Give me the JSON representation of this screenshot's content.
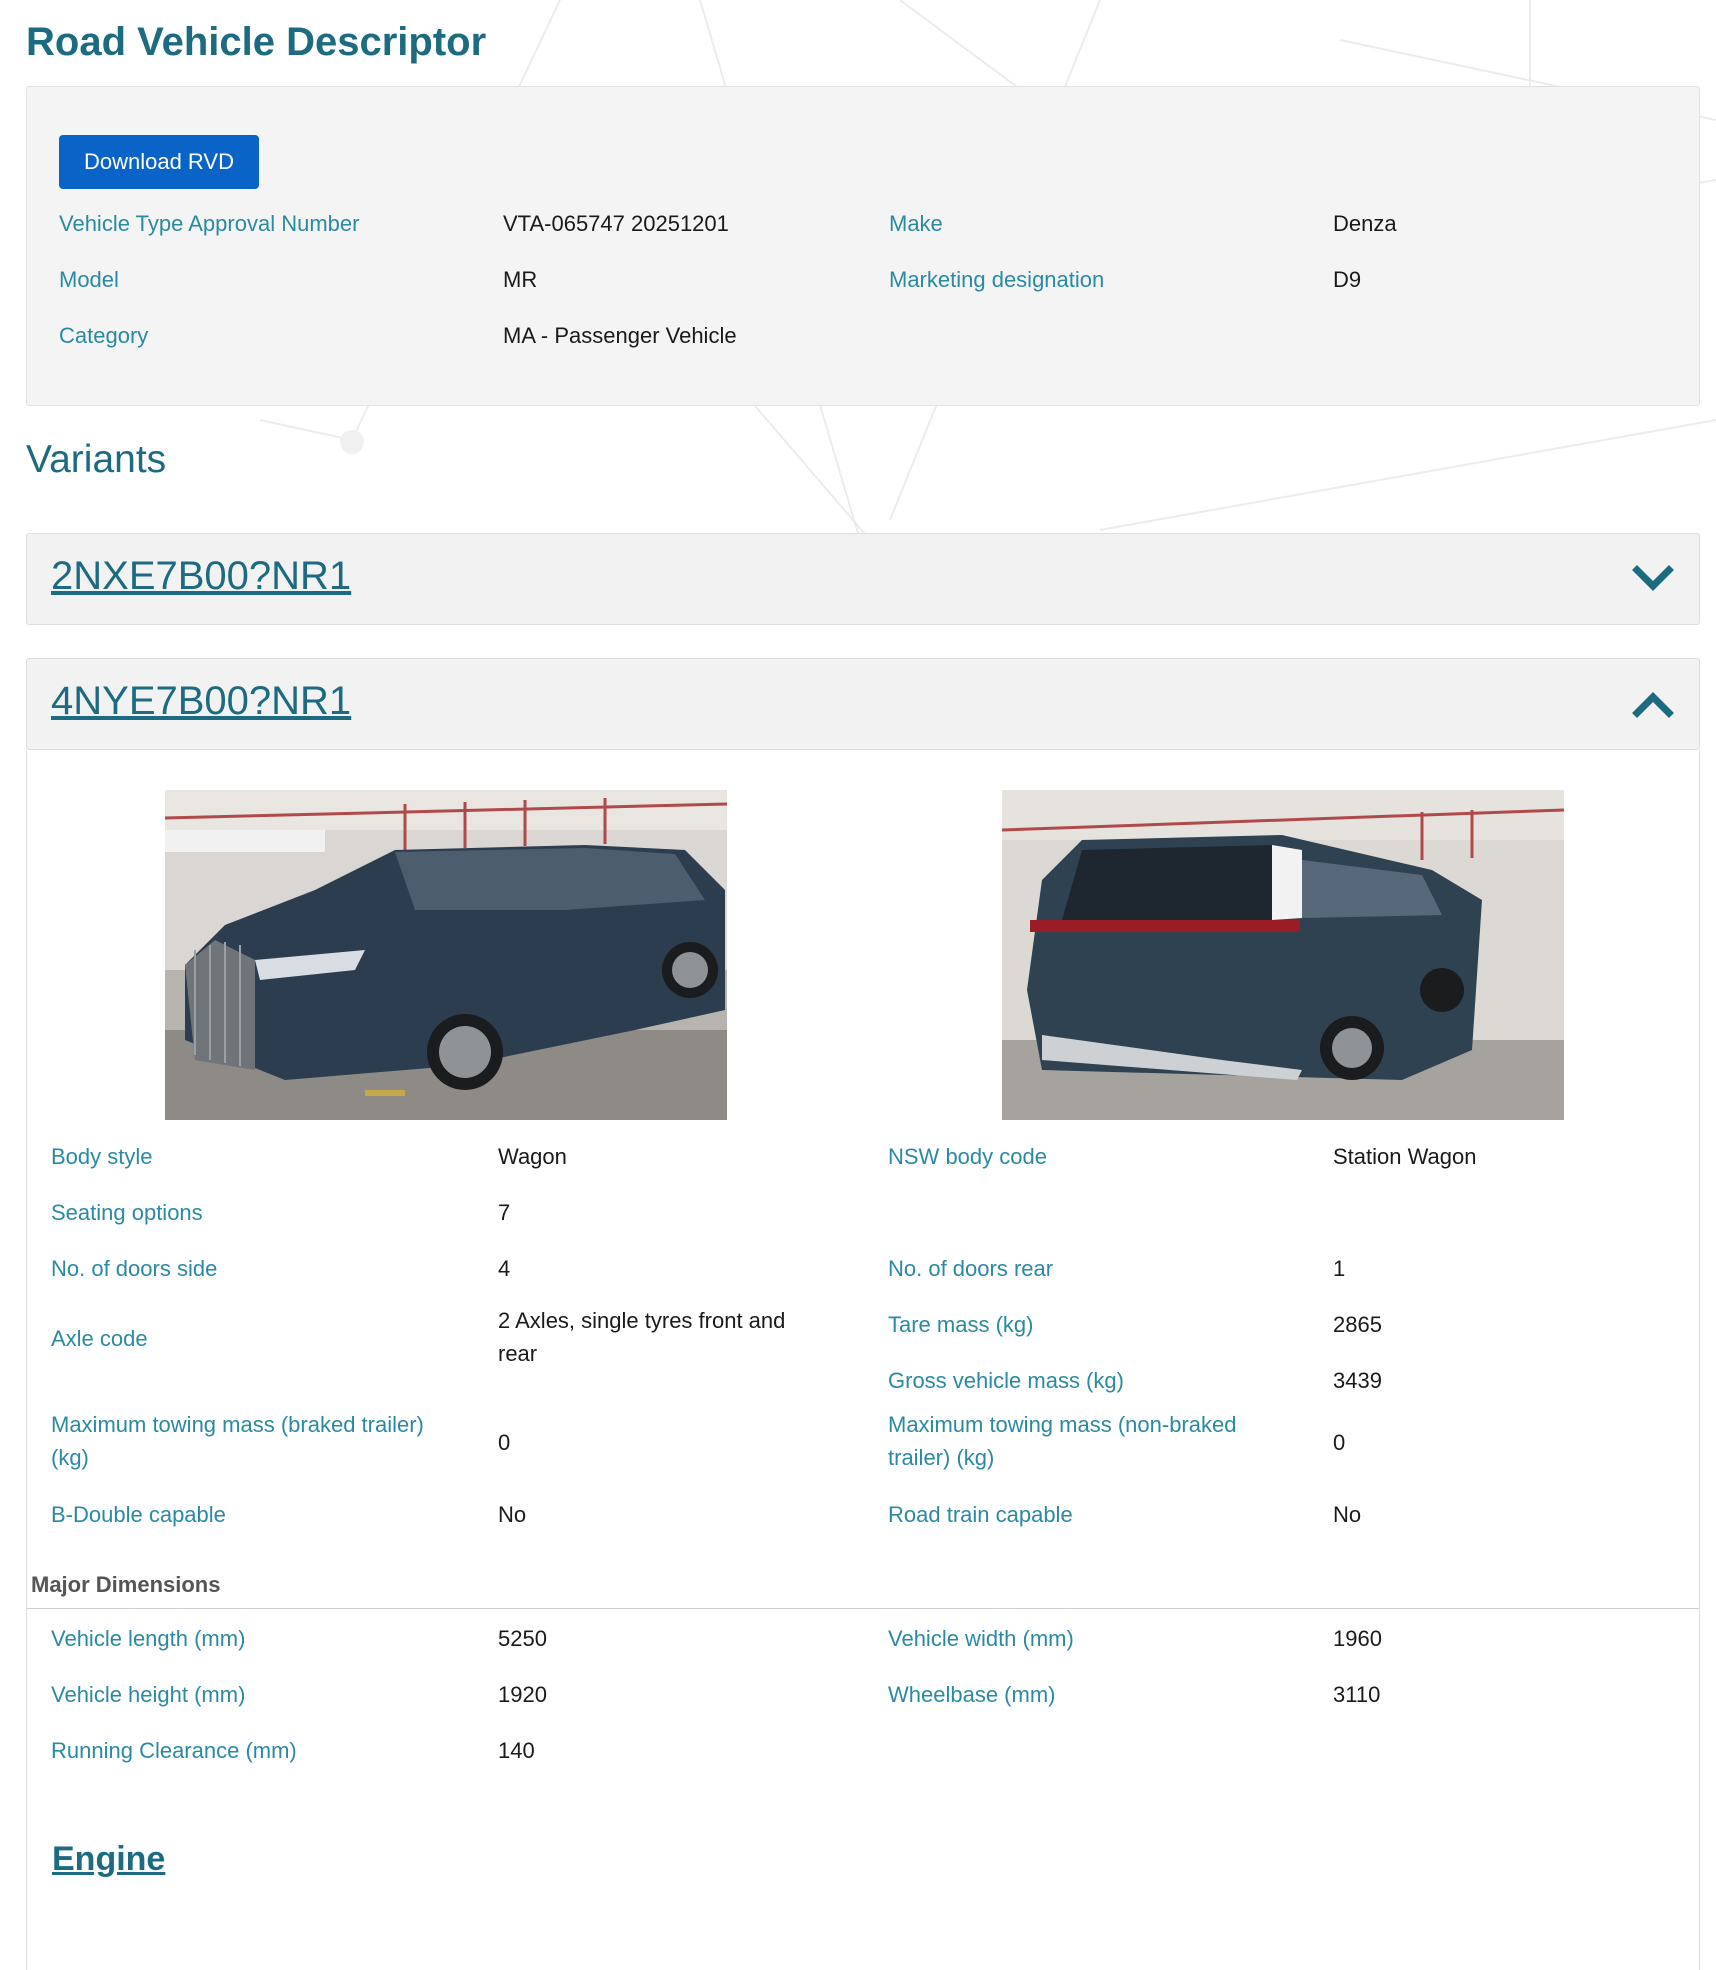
{
  "page": {
    "title": "Road Vehicle Descriptor"
  },
  "summary": {
    "download_label": "Download RVD",
    "vta_label": "Vehicle Type Approval Number",
    "vta_value": "VTA-065747 20251201",
    "make_label": "Make",
    "make_value": "Denza",
    "model_label": "Model",
    "model_value": "MR",
    "marketing_label": "Marketing designation",
    "marketing_value": "D9",
    "category_label": "Category",
    "category_value": "MA - Passenger Vehicle"
  },
  "variants": {
    "heading": "Variants",
    "items": [
      {
        "code": "2NXE7B00?NR1",
        "expanded": false,
        "icon": "chevron-down-icon"
      },
      {
        "code": "4NYE7B00?NR1",
        "expanded": true,
        "icon": "chevron-up-icon"
      }
    ]
  },
  "detail": {
    "body_style_label": "Body style",
    "body_style_value": "Wagon",
    "nsw_body_code_label": "NSW body code",
    "nsw_body_code_value": "Station Wagon",
    "seating_label": "Seating options",
    "seating_value": "7",
    "doors_side_label": "No. of doors side",
    "doors_side_value": "4",
    "doors_rear_label": "No. of doors rear",
    "doors_rear_value": "1",
    "axle_label": "Axle code",
    "axle_value_line1": "2 Axles, single tyres front and",
    "axle_value_line2": "rear",
    "tare_label": "Tare mass (kg)",
    "tare_value": "2865",
    "gvm_label": "Gross vehicle mass (kg)",
    "gvm_value": "3439",
    "tow_braked_label_line1": "Maximum towing mass (braked trailer)",
    "tow_braked_label_line2": "(kg)",
    "tow_braked_value": "0",
    "tow_unbraked_label_line1": "Maximum towing mass (non-braked",
    "tow_unbraked_label_line2": "trailer) (kg)",
    "tow_unbraked_value": "0",
    "bdouble_label": "B-Double capable",
    "bdouble_value": "No",
    "roadtrain_label": "Road train capable",
    "roadtrain_value": "No"
  },
  "dimensions": {
    "heading": "Major Dimensions",
    "length_label": "Vehicle length (mm)",
    "length_value": "5250",
    "width_label": "Vehicle width (mm)",
    "width_value": "1960",
    "height_label": "Vehicle height (mm)",
    "height_value": "1920",
    "wheelbase_label": "Wheelbase (mm)",
    "wheelbase_value": "3110",
    "clearance_label": "Running Clearance (mm)",
    "clearance_value": "140"
  },
  "engine": {
    "link_label": "Engine"
  },
  "colors": {
    "accent": "#1c6b80",
    "label": "#2a8aa4",
    "button": "#0a64c8",
    "panel": "#f4f4f4"
  }
}
